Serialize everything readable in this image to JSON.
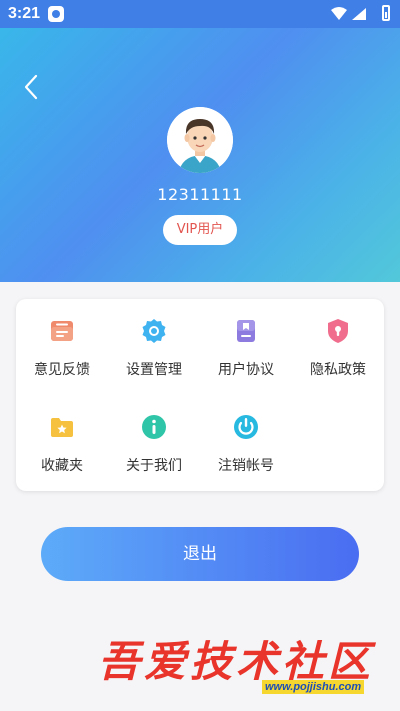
{
  "status_bar": {
    "time": "3:21"
  },
  "profile": {
    "username": "12311111",
    "badge": "VIP用户"
  },
  "menu": {
    "items": [
      {
        "label": "意见反馈",
        "icon": "feedback-icon",
        "color": "#f08a6d"
      },
      {
        "label": "设置管理",
        "icon": "gear-icon",
        "color": "#3fb2f0"
      },
      {
        "label": "用户协议",
        "icon": "document-icon",
        "color": "#8e7bdf"
      },
      {
        "label": "隐私政策",
        "icon": "shield-icon",
        "color": "#f06d8d"
      },
      {
        "label": "收藏夹",
        "icon": "folder-star-icon",
        "color": "#f6c13e"
      },
      {
        "label": "关于我们",
        "icon": "info-icon",
        "color": "#2fc5a8"
      },
      {
        "label": "注销帐号",
        "icon": "power-icon",
        "color": "#27b9e0"
      }
    ]
  },
  "logout": {
    "label": "退出"
  },
  "watermark": {
    "text": "吾爱技术社区",
    "url": "www.pojjishu.com"
  },
  "colors": {
    "accent": "#4a6df1",
    "vip_text": "#e2554f"
  }
}
